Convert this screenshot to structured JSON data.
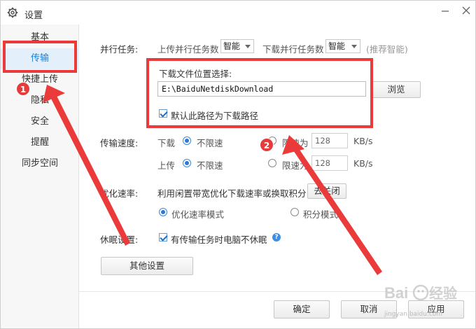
{
  "window": {
    "title": "设置"
  },
  "sidebar": {
    "items": [
      {
        "label": "基本"
      },
      {
        "label": "传输"
      },
      {
        "label": "快捷上传"
      },
      {
        "label": "隐私"
      },
      {
        "label": "安全"
      },
      {
        "label": "提醒"
      },
      {
        "label": "同步空间"
      }
    ],
    "active_index": 1
  },
  "parallel": {
    "section_label": "并行任务:",
    "upload_label": "上传并行任务数",
    "upload_value": "智能",
    "download_label": "下载并行任务数",
    "download_value": "智能",
    "recommend": "(推荐智能)"
  },
  "download_location": {
    "title": "下载文件位置选择:",
    "path": "E:\\BaiduNetdiskDownload",
    "browse_label": "浏览",
    "default_checkbox_label": "默认此路径为下载路径",
    "default_checked": true
  },
  "speed": {
    "section_label": "传输速度:",
    "download_label": "下载",
    "upload_label": "上传",
    "unlimited_label": "不限速",
    "limit_label": "限速为",
    "download_limit_value": "128",
    "upload_limit_value": "128",
    "unit": "KB/s"
  },
  "optimize": {
    "section_label": "优化速率:",
    "description": "利用闲置带宽优化下载速率或换取积分",
    "close_button": "去关闭",
    "mode_speed": "优化速率模式",
    "mode_points": "积分模式"
  },
  "sleep": {
    "section_label": "休眠设置:",
    "checkbox_label": "有传输任务时电脑不休眠",
    "checked": true
  },
  "buttons": {
    "other_settings": "其他设置",
    "ok": "确定",
    "cancel": "取消",
    "apply": "应用"
  },
  "annotations": {
    "badge_1": "1",
    "badge_2": "2",
    "color": "#ea3a3a"
  },
  "watermark": {
    "text": "jingyan.baidu.com"
  }
}
